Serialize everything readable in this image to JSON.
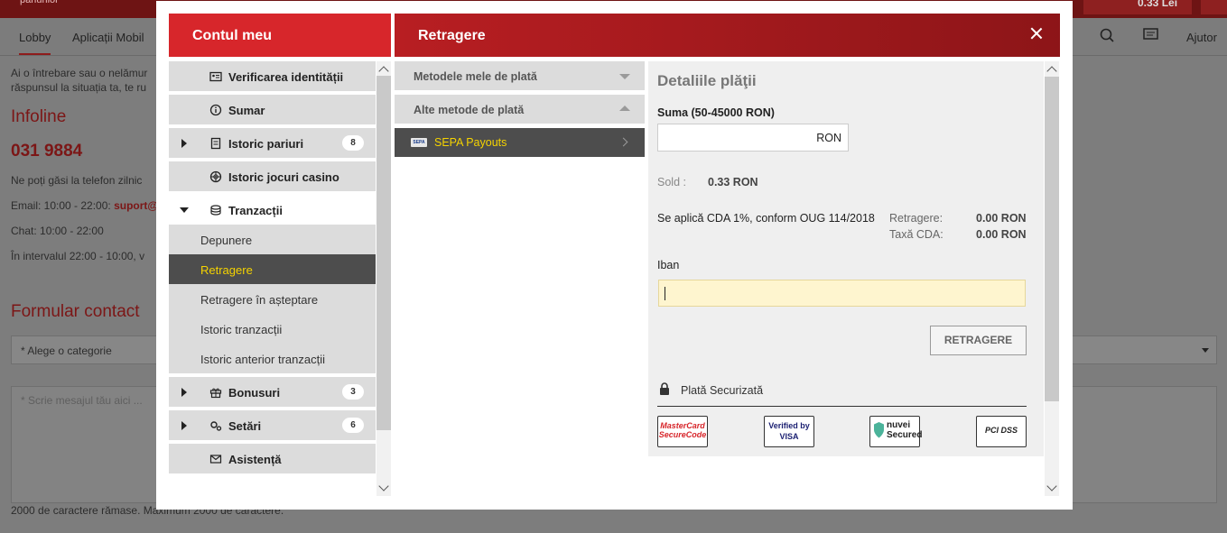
{
  "background": {
    "logo_text": "pariurilor",
    "balance": "0.33 Lei",
    "nav": [
      "Lobby",
      "Aplicații Mobil"
    ],
    "nav_right": "Ajutor",
    "intro_line1": "Ai o întrebare sau o nelămur",
    "intro_line2": "răspunsul la situația ta, te ru",
    "infoline_title": "Infoline",
    "phone": "031 9884",
    "phone_text": "Ne poți găsi la telefon zilnic",
    "email_text": "Email: 10:00 - 22:00:",
    "email_link": "suport@",
    "chat_text": "Chat: 10:00 - 22:00",
    "interval_text": "În intervalul 22:00 - 10:00, v",
    "form_title": "Formular contact",
    "category_placeholder": "* Alege o categorie",
    "message_placeholder": "* Scrie mesajul tău aici ...",
    "chars_left": "2000 de caractere rămase. Maximum 2000 de caractere."
  },
  "modal": {
    "left_title": "Contul meu",
    "right_title": "Retragere",
    "menu": [
      {
        "label": "Verificarea identității",
        "icon": "id-card-icon"
      },
      {
        "label": "Sumar",
        "icon": "info-icon"
      },
      {
        "label": "Istoric pariuri",
        "icon": "receipt-icon",
        "badge": "8"
      },
      {
        "label": "Istoric jocuri casino",
        "icon": "chip-icon"
      },
      {
        "label": "Tranzacții",
        "icon": "coins-icon"
      }
    ],
    "submenu": [
      "Depunere",
      "Retragere",
      "Retragere în așteptare",
      "Istoric tranzacții",
      "Istoric anterior tranzacții"
    ],
    "menu_after": [
      {
        "label": "Bonusuri",
        "icon": "gift-icon",
        "badge": "3"
      },
      {
        "label": "Setări",
        "icon": "gears-icon",
        "badge": "6"
      },
      {
        "label": "Asistență",
        "icon": "envelope-icon"
      }
    ],
    "methods": {
      "my_methods": "Metodele mele de plată",
      "other_methods": "Alte metode de plată",
      "selected": "SEPA Payouts",
      "sepa_badge": "SEPA"
    },
    "details": {
      "title": "Detaliile plăţii",
      "amount_label": "Suma (50-45000 RON)",
      "amount_currency": "RON",
      "balance_label": "Sold :",
      "balance_value": "0.33 RON",
      "cda_note": "Se aplică CDA 1%, conform OUG 114/2018",
      "withdraw_label": "Retragere:",
      "withdraw_value": "0.00 RON",
      "tax_label": "Taxă CDA:",
      "tax_value": "0.00 RON",
      "iban_label": "Iban",
      "button": "RETRAGERE",
      "secure": "Plată Securizată",
      "logos": [
        "MasterCard SecureCode",
        "Verified by VISA",
        "nuvei Secured",
        "PCI DSS"
      ]
    }
  }
}
